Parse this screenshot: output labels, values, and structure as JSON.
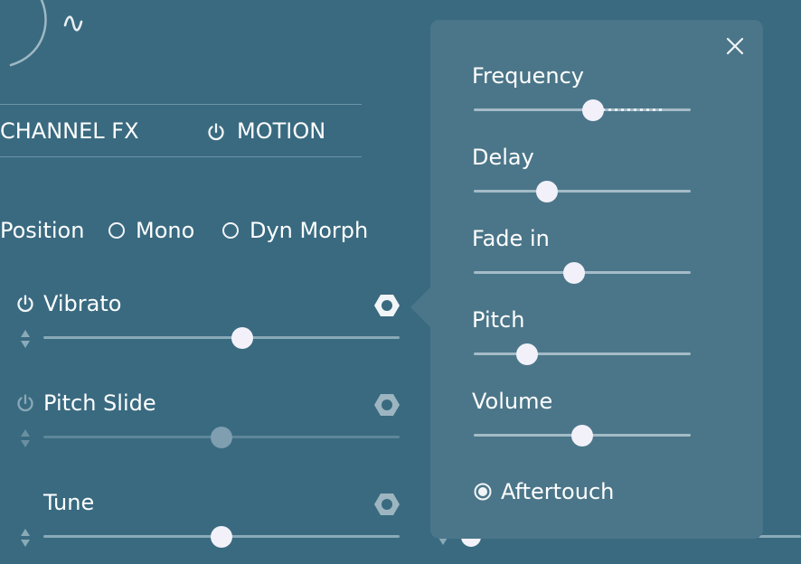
{
  "tabs": {
    "channel_fx": "CHANNEL FX",
    "motion": "MOTION"
  },
  "options": {
    "position": "Position",
    "mono": "Mono",
    "dyn_morph": "Dyn Morph"
  },
  "modulators": [
    {
      "label": "Vibrato",
      "value": 0.56,
      "enabled": true
    },
    {
      "label": "Pitch Slide",
      "value": 0.5,
      "enabled": false
    },
    {
      "label": "Tune",
      "value": 0.5,
      "enabled": true
    }
  ],
  "popup": {
    "params": [
      {
        "label": "Frequency",
        "value": 0.56
      },
      {
        "label": "Delay",
        "value": 0.34
      },
      {
        "label": "Fade in",
        "value": 0.47
      },
      {
        "label": "Pitch",
        "value": 0.25
      },
      {
        "label": "Volume",
        "value": 0.51
      }
    ],
    "aftertouch_label": "Aftertouch",
    "aftertouch_selected": true
  },
  "icons": {
    "close": "close-icon",
    "power": "power-icon",
    "hex": "hex-nut-icon",
    "sine": "sine-wave-icon",
    "updown": "up-down-arrows-icon"
  }
}
